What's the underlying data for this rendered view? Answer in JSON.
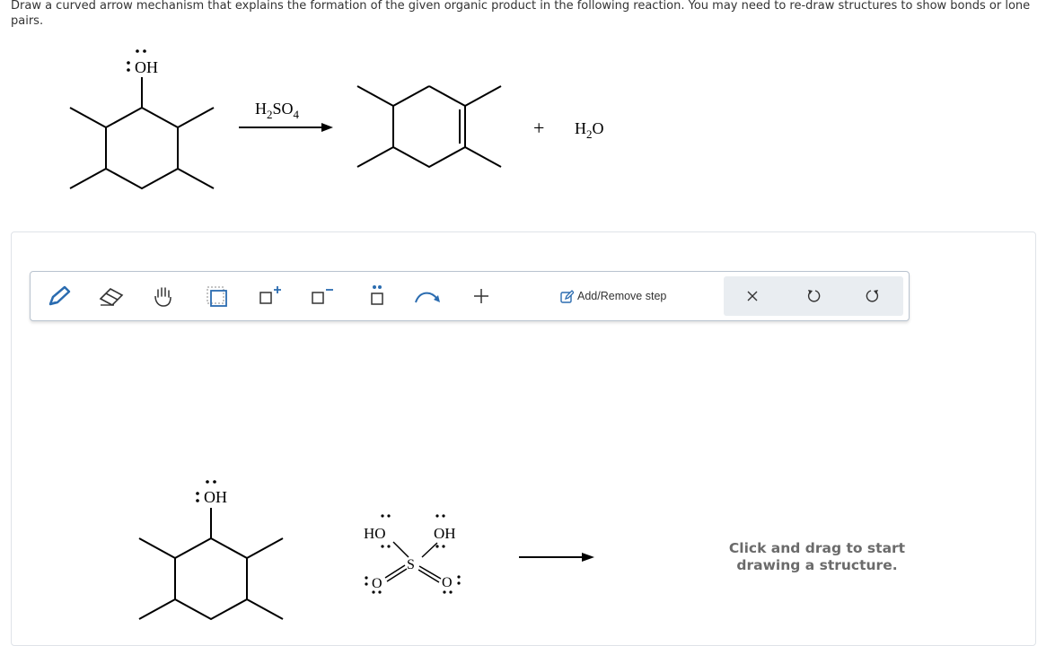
{
  "question": {
    "instructions": "Draw a curved arrow mechanism that explains the formation of the given organic product in the following reaction. You may need to re-draw structures to show bonds or lone pairs."
  },
  "reaction": {
    "reactant_group": "OH",
    "reagent_main": "H",
    "reagent_sub1": "2",
    "reagent_mid": "SO",
    "reagent_sub2": "4",
    "plus": "+",
    "byproduct_main": "H",
    "byproduct_sub": "2",
    "byproduct_end": "O"
  },
  "toolbar": {
    "tools": [
      {
        "name": "pencil-icon",
        "label": "Draw bond"
      },
      {
        "name": "eraser-icon",
        "label": "Erase"
      },
      {
        "name": "hand-icon",
        "label": "Move"
      },
      {
        "name": "select-box-icon",
        "label": "Select"
      },
      {
        "name": "positive-charge-icon",
        "label": "+"
      },
      {
        "name": "negative-charge-icon",
        "label": "−"
      },
      {
        "name": "lone-pair-icon",
        "label": "Lone pair"
      },
      {
        "name": "curved-arrow-icon",
        "label": "Curved arrow"
      },
      {
        "name": "plus-icon",
        "label": "+"
      }
    ],
    "add_remove_label": "Add/Remove step",
    "close_symbol": "×"
  },
  "canvas": {
    "reactant_group": "OH",
    "acid_left": "HO",
    "acid_right": "OH",
    "acid_center": "S",
    "acid_o_left": "O",
    "acid_o_right": "O",
    "hint": "Click and drag to start drawing a structure."
  },
  "colors": {
    "accent": "#2b6cb0",
    "toolbar_border": "#b9c3cf",
    "hint": "#6b6b6b"
  }
}
